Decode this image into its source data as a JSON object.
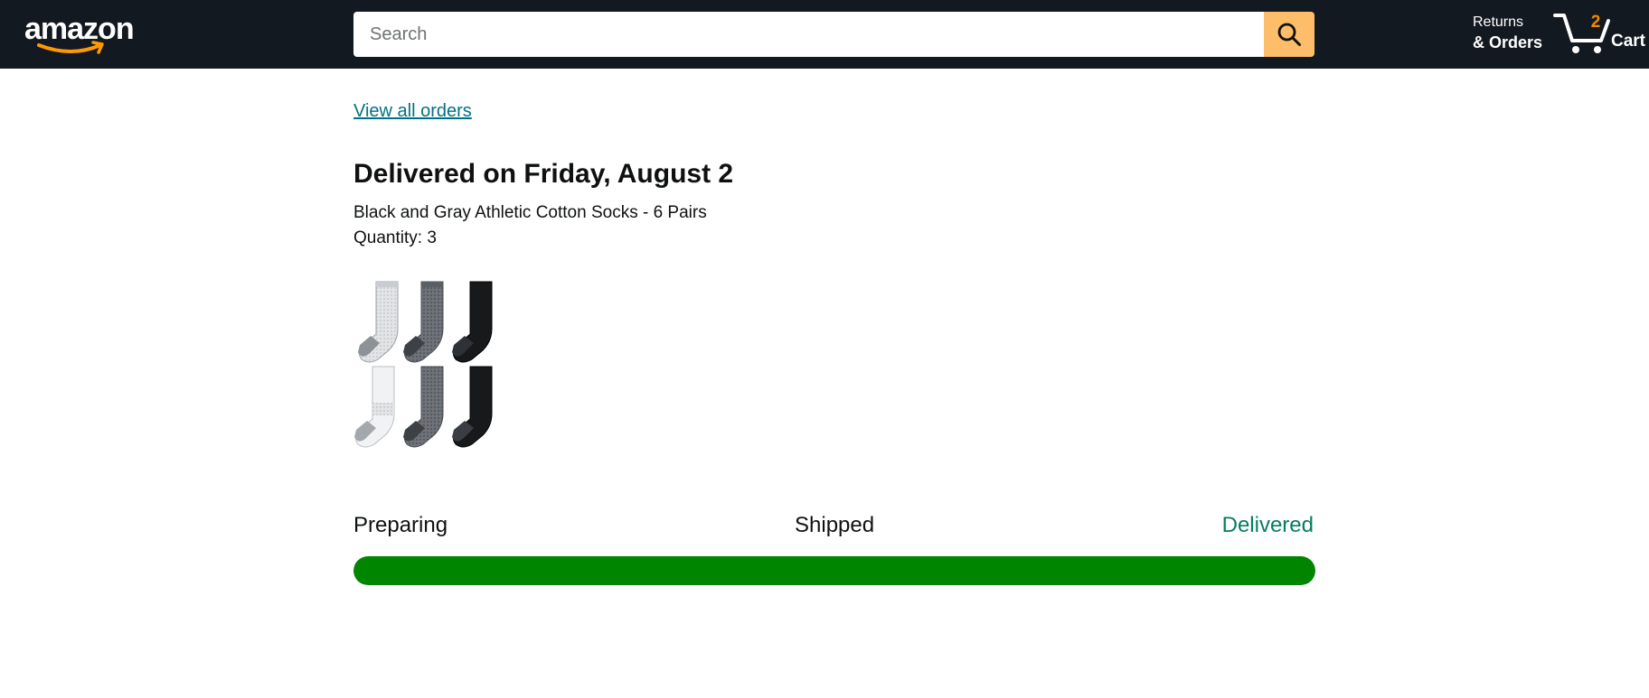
{
  "header": {
    "logo_text": "amazon",
    "search": {
      "placeholder": "Search",
      "value": ""
    },
    "returns": {
      "line1": "Returns",
      "line2": "& Orders"
    },
    "cart": {
      "count": "2",
      "label": "Cart"
    }
  },
  "order": {
    "view_all_link": "View all orders",
    "status_title": "Delivered on Friday, August 2",
    "product_name": "Black and Gray Athletic Cotton Socks - 6 Pairs",
    "quantity": "Quantity: 3",
    "product_image_icon": "socks-six-pack-image"
  },
  "tracker": {
    "stages": [
      "Preparing",
      "Shipped",
      "Delivered"
    ],
    "progress_percent": 100,
    "fill_color": "#008500",
    "current_stage_color": "#067d62"
  },
  "colors": {
    "nav_background": "#131921",
    "search_button": "#febd69",
    "link": "#007185",
    "cart_count": "#f08804"
  }
}
